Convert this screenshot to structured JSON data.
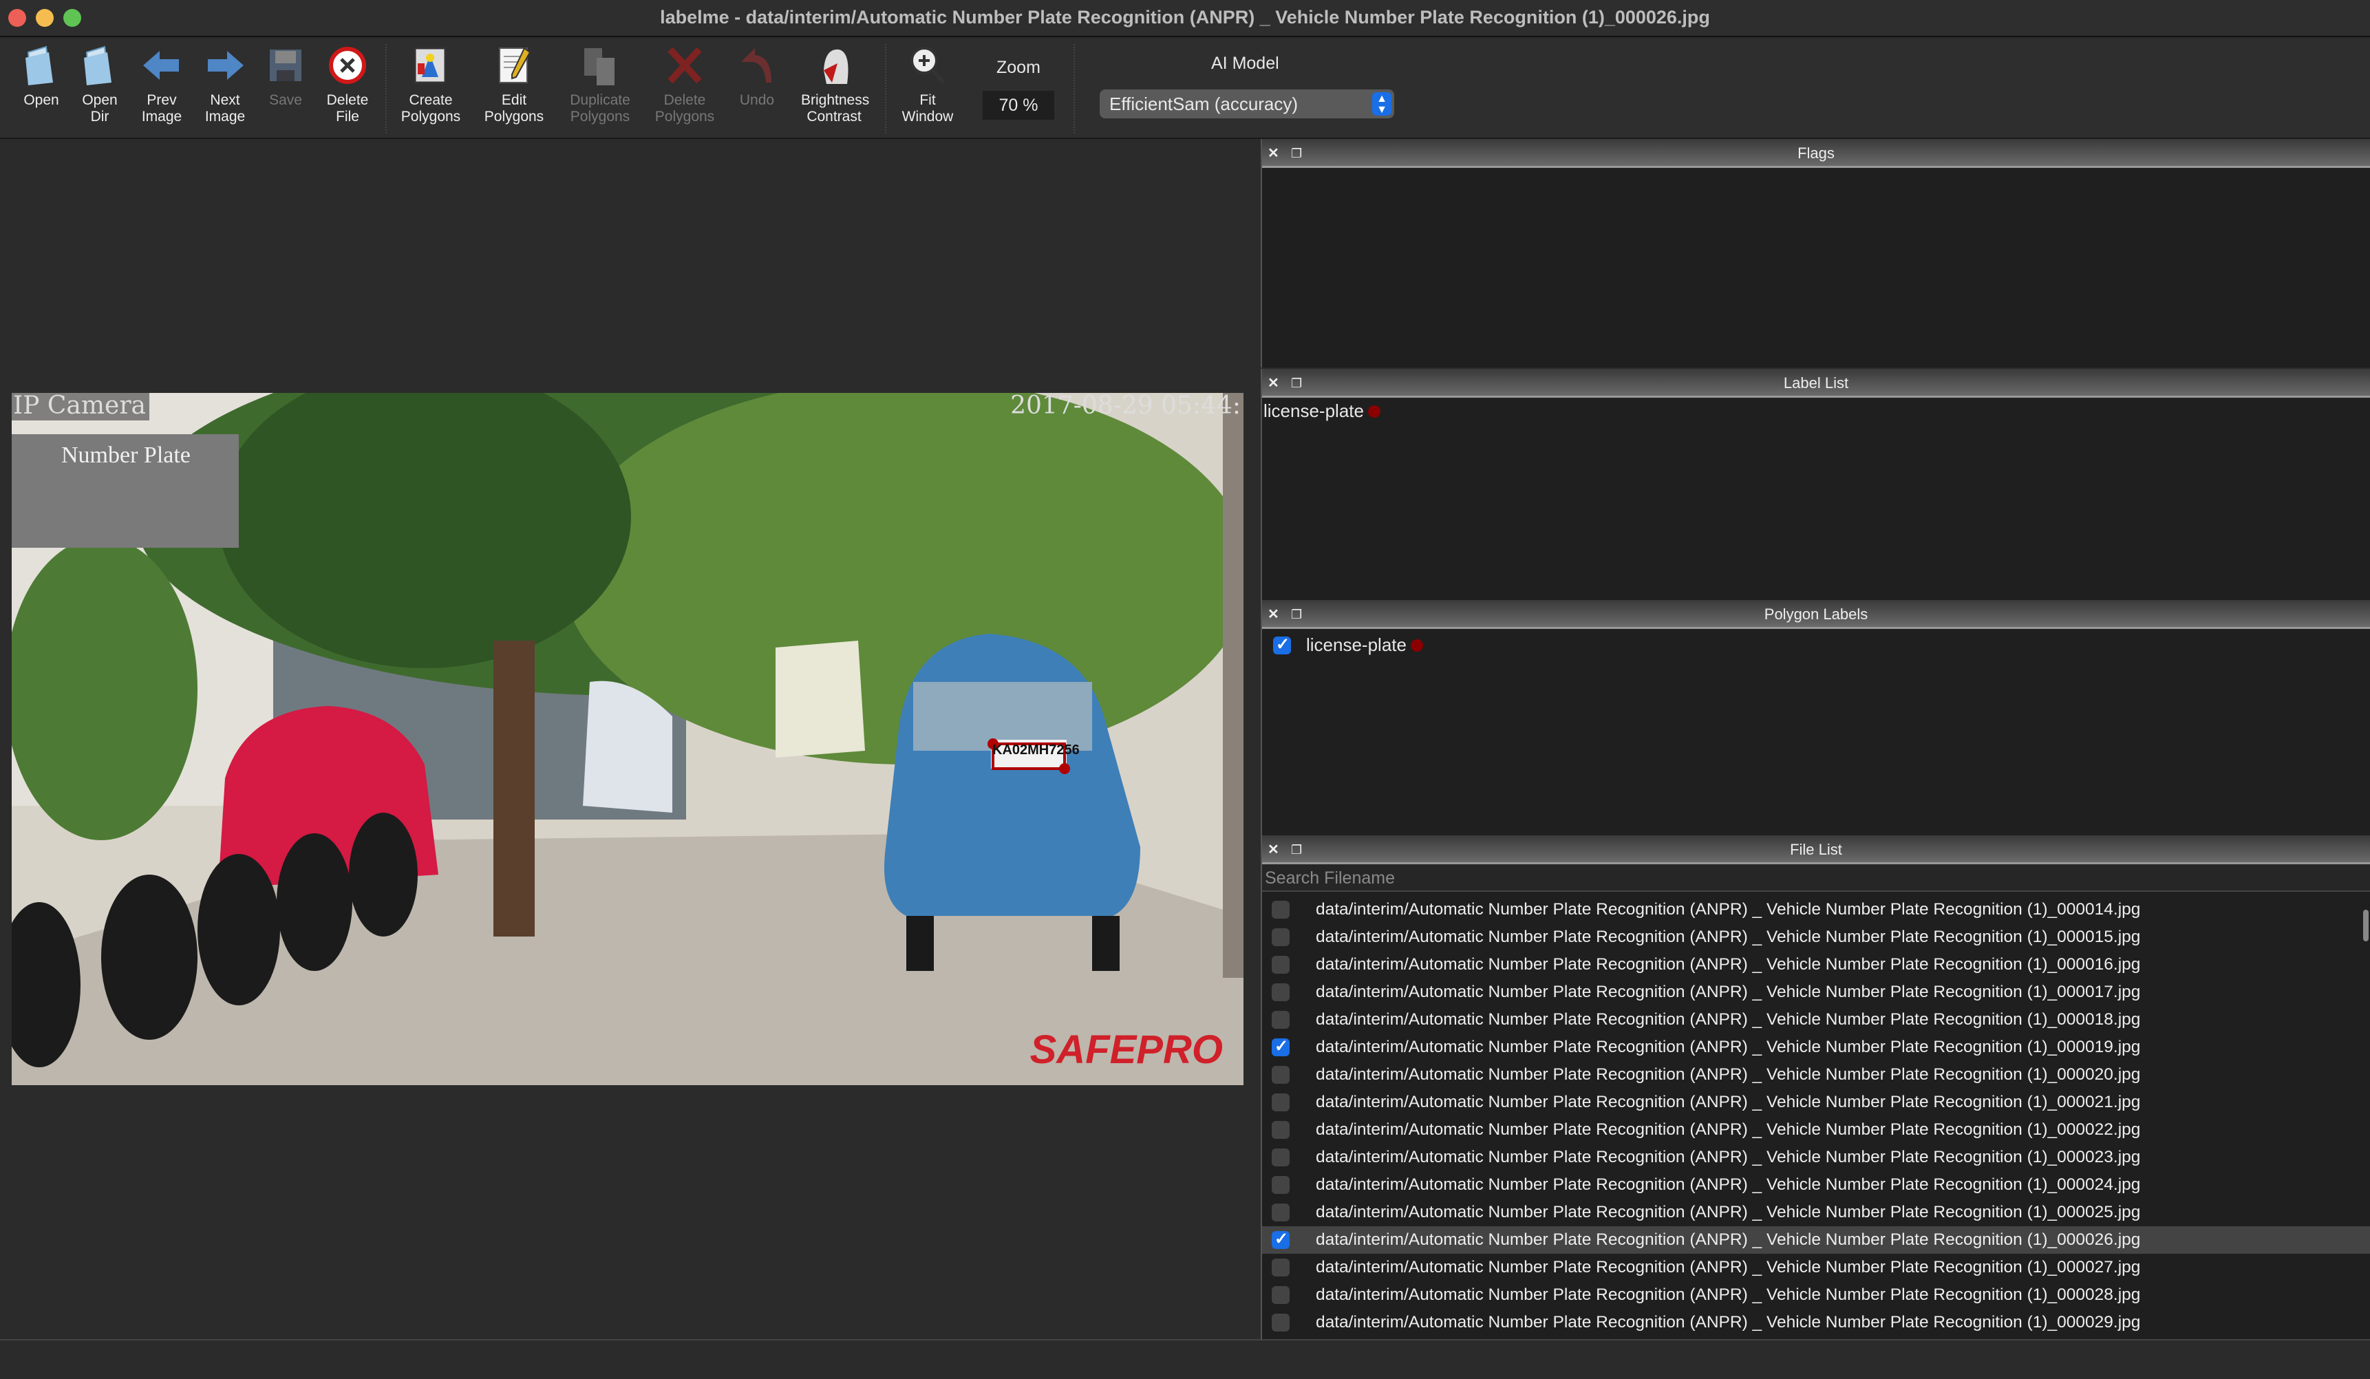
{
  "window": {
    "title": "labelme - data/interim/Automatic Number Plate Recognition (ANPR) _ Vehicle Number Plate Recognition (1)_000026.jpg"
  },
  "toolbar": {
    "buttons": [
      {
        "label": "Open",
        "icon": "open-folder-icon",
        "enabled": true
      },
      {
        "label": "Open\nDir",
        "icon": "open-dir-icon",
        "enabled": true
      },
      {
        "label": "Prev\nImage",
        "icon": "arrow-left-icon",
        "enabled": true
      },
      {
        "label": "Next\nImage",
        "icon": "arrow-right-icon",
        "enabled": true
      },
      {
        "label": "Save",
        "icon": "save-icon",
        "enabled": false
      },
      {
        "label": "Delete\nFile",
        "icon": "delete-file-icon",
        "enabled": true
      },
      {
        "label": "Create\nPolygons",
        "icon": "create-polygon-icon",
        "enabled": true
      },
      {
        "label": "Edit\nPolygons",
        "icon": "edit-polygon-icon",
        "enabled": true
      },
      {
        "label": "Duplicate\nPolygons",
        "icon": "duplicate-icon",
        "enabled": false
      },
      {
        "label": "Delete\nPolygons",
        "icon": "delete-polygon-icon",
        "enabled": false
      },
      {
        "label": "Undo",
        "icon": "undo-icon",
        "enabled": false
      },
      {
        "label": "Brightness\nContrast",
        "icon": "brightness-icon",
        "enabled": true
      },
      {
        "label": "Fit\nWindow",
        "icon": "fit-window-icon",
        "enabled": true
      }
    ],
    "zoom_label": "Zoom",
    "zoom_value": "70 %",
    "ai_model_label": "AI Model",
    "ai_model_value": "EfficientSam (accuracy)"
  },
  "image_overlay": {
    "camera": "IP Camera",
    "timestamp": "2017-08-29 05:44:",
    "box": "Number Plate",
    "watermark": "SAFEPRO",
    "plate": "KA02MH7256"
  },
  "docks": {
    "flags": {
      "title": "Flags"
    },
    "label_list": {
      "title": "Label List",
      "items": [
        {
          "label": "license-plate",
          "color": "#8b0000"
        }
      ]
    },
    "polygon_labels": {
      "title": "Polygon Labels",
      "items": [
        {
          "label": "license-plate",
          "checked": true,
          "color": "#8b0000"
        }
      ]
    },
    "file_list": {
      "title": "File List",
      "search_placeholder": "Search Filename",
      "files": [
        {
          "name": "data/interim/Automatic Number Plate Recognition (ANPR) _ Vehicle Number Plate Recognition (1)_000014.jpg",
          "checked": false
        },
        {
          "name": "data/interim/Automatic Number Plate Recognition (ANPR) _ Vehicle Number Plate Recognition (1)_000015.jpg",
          "checked": false
        },
        {
          "name": "data/interim/Automatic Number Plate Recognition (ANPR) _ Vehicle Number Plate Recognition (1)_000016.jpg",
          "checked": false
        },
        {
          "name": "data/interim/Automatic Number Plate Recognition (ANPR) _ Vehicle Number Plate Recognition (1)_000017.jpg",
          "checked": false
        },
        {
          "name": "data/interim/Automatic Number Plate Recognition (ANPR) _ Vehicle Number Plate Recognition (1)_000018.jpg",
          "checked": false
        },
        {
          "name": "data/interim/Automatic Number Plate Recognition (ANPR) _ Vehicle Number Plate Recognition (1)_000019.jpg",
          "checked": true
        },
        {
          "name": "data/interim/Automatic Number Plate Recognition (ANPR) _ Vehicle Number Plate Recognition (1)_000020.jpg",
          "checked": false
        },
        {
          "name": "data/interim/Automatic Number Plate Recognition (ANPR) _ Vehicle Number Plate Recognition (1)_000021.jpg",
          "checked": false
        },
        {
          "name": "data/interim/Automatic Number Plate Recognition (ANPR) _ Vehicle Number Plate Recognition (1)_000022.jpg",
          "checked": false
        },
        {
          "name": "data/interim/Automatic Number Plate Recognition (ANPR) _ Vehicle Number Plate Recognition (1)_000023.jpg",
          "checked": false
        },
        {
          "name": "data/interim/Automatic Number Plate Recognition (ANPR) _ Vehicle Number Plate Recognition (1)_000024.jpg",
          "checked": false
        },
        {
          "name": "data/interim/Automatic Number Plate Recognition (ANPR) _ Vehicle Number Plate Recognition (1)_000025.jpg",
          "checked": false
        },
        {
          "name": "data/interim/Automatic Number Plate Recognition (ANPR) _ Vehicle Number Plate Recognition (1)_000026.jpg",
          "checked": true,
          "selected": true
        },
        {
          "name": "data/interim/Automatic Number Plate Recognition (ANPR) _ Vehicle Number Plate Recognition (1)_000027.jpg",
          "checked": false
        },
        {
          "name": "data/interim/Automatic Number Plate Recognition (ANPR) _ Vehicle Number Plate Recognition (1)_000028.jpg",
          "checked": false
        },
        {
          "name": "data/interim/Automatic Number Plate Recognition (ANPR) _ Vehicle Number Plate Recognition (1)_000029.jpg",
          "checked": false
        }
      ]
    }
  }
}
